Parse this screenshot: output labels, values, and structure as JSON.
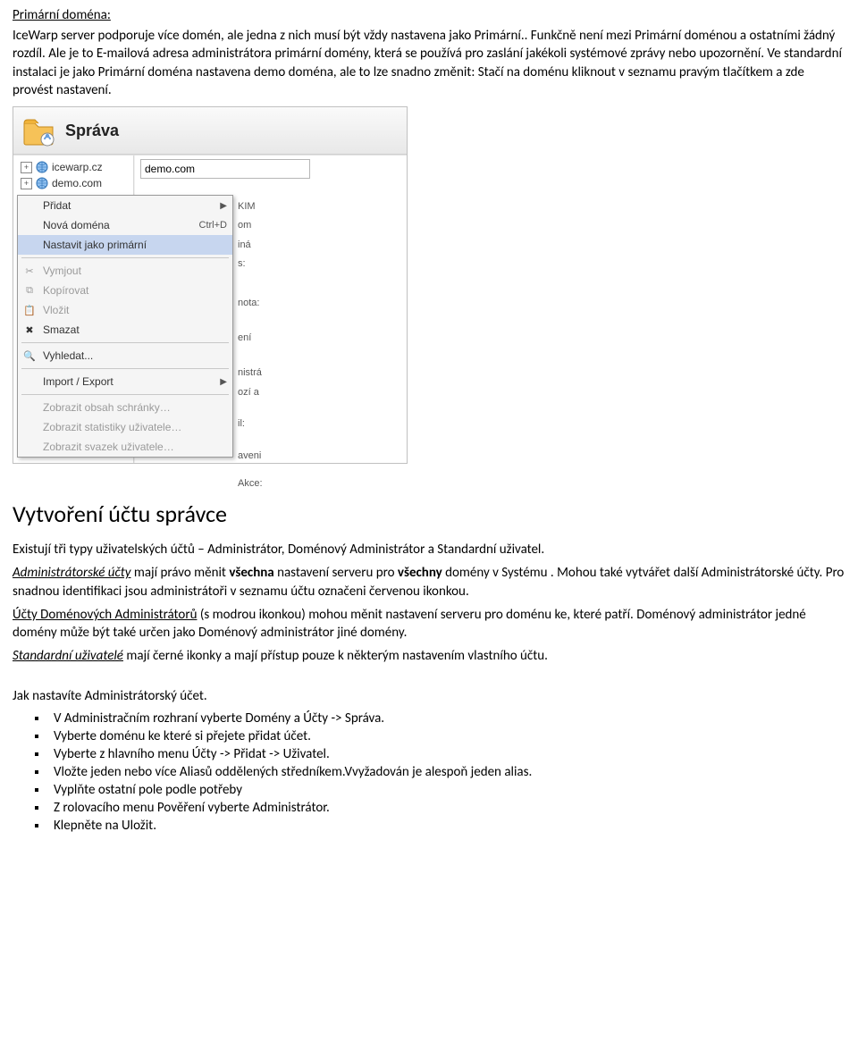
{
  "doc": {
    "title_1": "Primární doména:",
    "p1": "IceWarp server podporuje více domén, ale jedna z nich musí být vždy nastavena jako Primární.. Funkčně není mezi Primární doménou a ostatními žádný rozdíl. Ale je to E-mailová adresa administrátora primární domény, která se používá pro zaslání jakékoli systémové zprávy nebo upozornění. Ve standardní instalaci je jako Primární doména nastavena demo doména, ale to lze snadno změnit: Stačí na doménu kliknout v seznamu pravým tlačítkem a zde provést nastavení.",
    "title_2": "Vytvoření účtu správce",
    "p2": "Existují tři typy uživatelských účtů – Administrátor, Doménový Administrátor a Standardní uživatel.",
    "p3a_italic": "Administrátorské účty",
    "p3b": " mají právo měnit ",
    "p3c_bold": "všechna",
    "p3d": " nastavení serveru pro ",
    "p3e_bold": "všechny",
    "p3f": " domény v Systému . Mohou také vytvářet další Administrátorské účty. Pro snadnou identifikaci jsou administrátoři v seznamu účtu označeni červenou ikonkou.",
    "p4_uline": "Účty Doménových Administrátorů",
    "p4b": " (s modrou ikonkou) mohou měnit nastavení serveru pro doménu ke, které patří. Doménový administrátor jedné domény může být také určen jako Doménový administrátor jiné domény.",
    "p5a_italic": "Standardní uživatelé",
    "p5b": " mají černé ikonky a mají přístup pouze k některým nastavením vlastního účtu.",
    "p6": "Jak nastavíte Administrátorský účet.",
    "list": [
      "V Administračním rozhraní vyberte Domény a Účty -> Správa.",
      "Vyberte doménu ke které si přejete přidat účet.",
      "Vyberte z hlavního menu Účty -> Přidat -> Uživatel.",
      "Vložte jeden nebo více Aliasů oddělených středníkem.Vvyžadován je alespoň jeden alias.",
      "Vyplňte ostatní pole podle potřeby",
      "Z rolovacího menu Pověření vyberte Administrátor.",
      "Klepněte na Uložit."
    ]
  },
  "shot": {
    "header": "Správa",
    "tree": [
      "icewarp.cz",
      "demo.com"
    ],
    "demo_value": "demo.com",
    "menu": {
      "add": "Přidat",
      "new_domain": "Nová doména",
      "new_domain_shortcut": "Ctrl+D",
      "set_primary": "Nastavit jako primární",
      "cut": "Vymjout",
      "copy": "Kopírovat",
      "paste": "Vložit",
      "delete": "Smazat",
      "search": "Vyhledat...",
      "import_export": "Import / Export",
      "show_folder": "Zobrazit obsah schránky…",
      "show_stats": "Zobrazit statistiky uživatele…",
      "show_bundle": "Zobrazit svazek uživatele…"
    },
    "side": [
      "KIM",
      "om",
      "iná",
      "s:",
      "nota:",
      "ení",
      "nistrá",
      "ozí a",
      "il:",
      "aveni",
      "Akce:"
    ]
  }
}
